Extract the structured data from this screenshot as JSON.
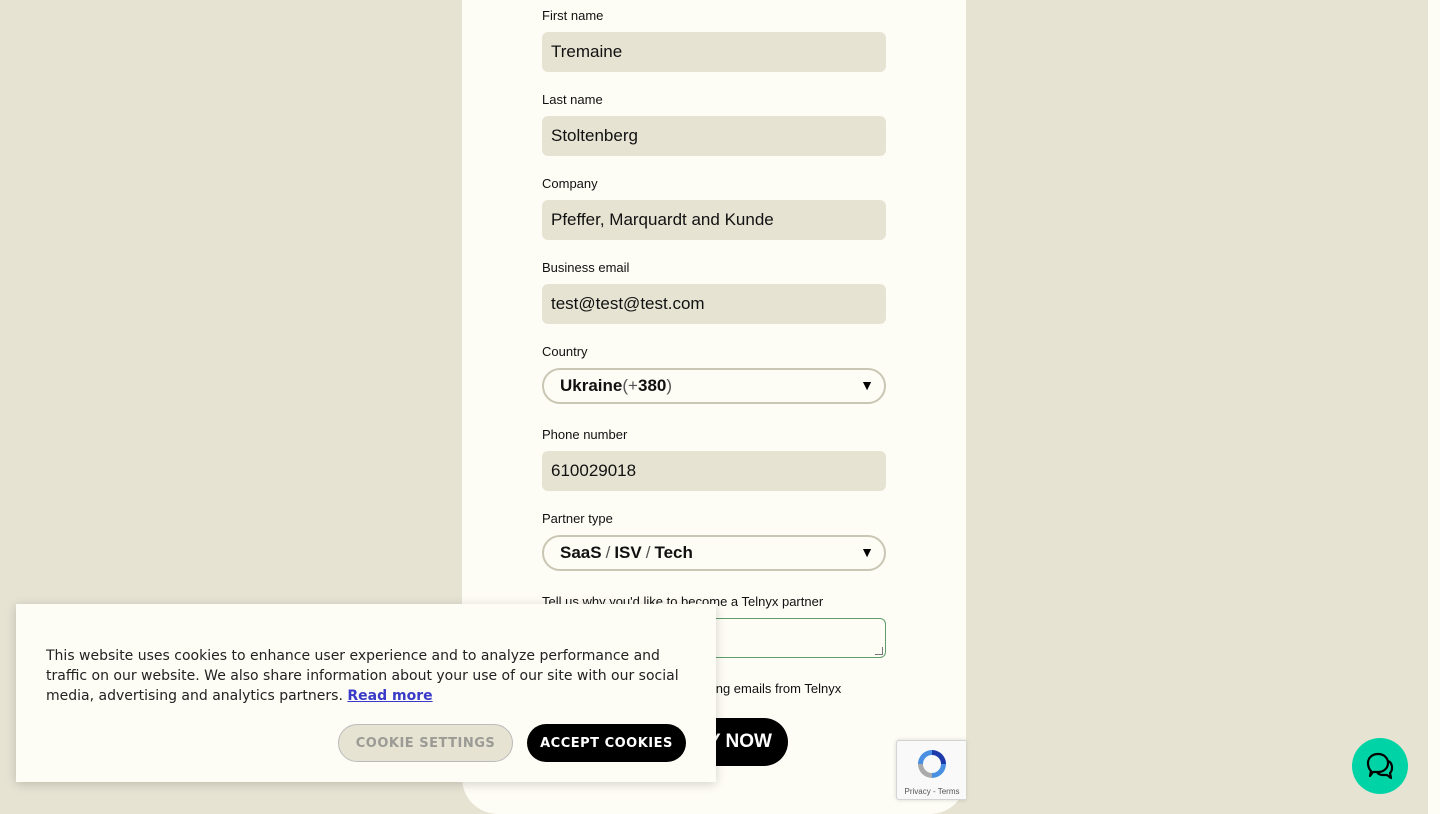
{
  "form": {
    "first_name": {
      "label": "First name",
      "value": "Tremaine"
    },
    "last_name": {
      "label": "Last name",
      "value": "Stoltenberg"
    },
    "company": {
      "label": "Company",
      "value": "Pfeffer, Marquardt and Kunde"
    },
    "business_email": {
      "label": "Business email",
      "value": "test@test@test.com"
    },
    "country": {
      "label": "Country",
      "name": "Ukraine",
      "open_paren": " (",
      "plus": "+",
      "code": "380",
      "close_paren": ")"
    },
    "phone_number": {
      "label": "Phone number",
      "value": "610029018"
    },
    "partner_type": {
      "label": "Partner type",
      "part1": "SaaS",
      "sep1": "/",
      "part2": "ISV",
      "sep2": "/",
      "part3": "Tech"
    },
    "reason": {
      "label": "Tell us why you'd like to become a Telnyx partner",
      "value": ""
    },
    "consent_partial": "eting emails from Telnyx",
    "apply_partial": "Y NOW"
  },
  "recaptcha": {
    "links": "Privacy - Terms"
  },
  "cookie_banner": {
    "text": "This website uses cookies to enhance user experience and to analyze performance and traffic on our website. We also share information about your use of our site with our social media, advertising and analytics partners.",
    "read_more": "Read more",
    "settings_label": "COOKIE SETTINGS",
    "accept_label": "ACCEPT COOKIES"
  },
  "icons": {
    "select_arrow": "chevron-down-icon",
    "chat": "chat-bubbles-icon",
    "recaptcha": "recaptcha-icon"
  },
  "colors": {
    "background": "#e6e3d3",
    "card": "#fefdf5",
    "accent": "#00d4a6",
    "primary": "#000000",
    "link": "#3a3ac8"
  }
}
